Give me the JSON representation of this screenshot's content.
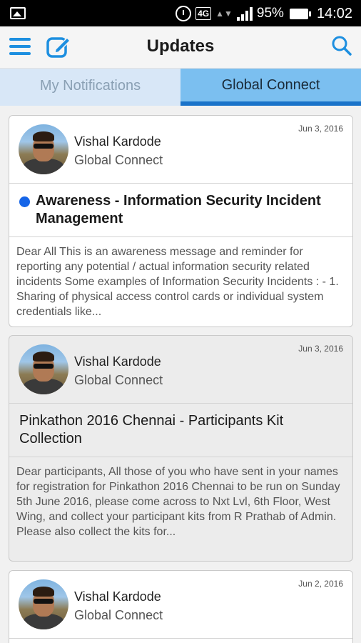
{
  "status_bar": {
    "network": "4G",
    "battery": "95%",
    "time": "14:02",
    "icons": [
      "gallery-icon",
      "alarm-icon",
      "signal-icon",
      "battery-icon"
    ]
  },
  "app_bar": {
    "title": "Updates",
    "accent_color": "#1d8fe0",
    "icons": [
      "menu-icon",
      "compose-icon",
      "search-icon"
    ]
  },
  "tabs": [
    {
      "label": "My Notifications",
      "active": false
    },
    {
      "label": "Global Connect",
      "active": true
    }
  ],
  "posts": [
    {
      "author": "Vishal Kardode",
      "channel": "Global Connect",
      "date": "Jun 3, 2016",
      "unread": true,
      "title": "Awareness - Information Security Incident Management",
      "excerpt": "Dear All This is an awareness message and reminder for reporting any potential / actual information security related incidents Some examples of Information Security Incidents : - 1. Sharing of physical access control cards or individual system credentials like..."
    },
    {
      "author": "Vishal Kardode",
      "channel": "Global Connect",
      "date": "Jun 3, 2016",
      "unread": false,
      "title": "Pinkathon 2016 Chennai - Participants Kit Collection",
      "excerpt": "Dear participants, All those of you who have sent in your names for registration for Pinkathon 2016 Chennai to be run on Sunday 5th June 2016, please come across to Nxt Lvl, 6th Floor, West Wing, and collect your participant kits from R Prathab of Admin. Please also collect the kits for..."
    },
    {
      "author": "Vishal Kardode",
      "channel": "Global Connect",
      "date": "Jun 2, 2016"
    }
  ]
}
